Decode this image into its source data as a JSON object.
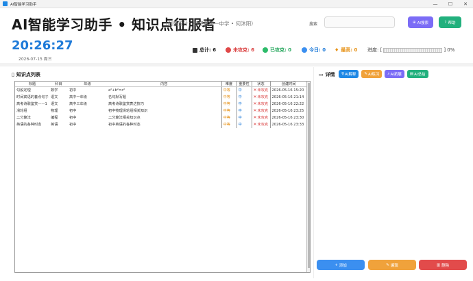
{
  "window": {
    "title": "AI智能学习助手",
    "controls": [
      "—",
      "☐",
      "✕"
    ]
  },
  "header": {
    "title": "AI智能学习助手 • 知识点征服者",
    "subtitle": "（创意设计：会泽县第一中学 • 何沐阳）",
    "search_label": "搜索",
    "search_value": "",
    "ai_search_label": "AI搜索",
    "help_label": "帮助"
  },
  "status": {
    "clock": "20:26:27",
    "date": "2026-07-15 周三",
    "total_label": "总计: 6",
    "undone_label": "未攻克: 6",
    "done_label": "已攻克: 0",
    "today_label": "今日: 0",
    "max_label": "最高: 0",
    "progress_prefix": "进度: [",
    "progress_suffix": "] 0%",
    "progress_value": 0
  },
  "knowledge_list": {
    "title": "知识点列表",
    "columns": [
      "标题",
      "科目",
      "年级",
      "内容",
      "难度",
      "重要性",
      "状态",
      "创建时间"
    ],
    "rows": [
      {
        "title": "勾股定理",
        "subject": "数学",
        "grade": "初中",
        "content": "a²+b²=c²",
        "difficulty": "中等",
        "importance": "中",
        "status": "未攻克",
        "created": "2026-05-16 15:20"
      },
      {
        "title": "时间宾语的套点句子",
        "subject": "语文",
        "grade": "高中一年级",
        "content": "名句默写题",
        "difficulty": "中等",
        "importance": "中",
        "status": "未攻克",
        "created": "2026-05-16 21:14"
      },
      {
        "title": "高考诗歌鉴赏——1",
        "subject": "语文",
        "grade": "高中三年级",
        "content": "高考诗歌鉴赏表达技巧",
        "difficulty": "中等",
        "importance": "中",
        "status": "未攻克",
        "created": "2026-05-16 22:22"
      },
      {
        "title": "滑轮组",
        "subject": "物理",
        "grade": "初中",
        "content": "初中物理滑轮组相关知识",
        "difficulty": "中等",
        "importance": "中",
        "status": "未攻克",
        "created": "2026-05-16 23:25"
      },
      {
        "title": "二分算法",
        "subject": "编程",
        "grade": "初中",
        "content": "二分算法相关知识点",
        "difficulty": "中等",
        "importance": "中",
        "status": "未攻克",
        "created": "2026-05-16 23:30"
      },
      {
        "title": "英语的各种时态",
        "subject": "英语",
        "grade": "初中",
        "content": "初中英语的各种时态",
        "difficulty": "中等",
        "importance": "中",
        "status": "未攻克",
        "created": "2026-05-16 23:33"
      }
    ]
  },
  "details": {
    "title": "详情",
    "buttons": {
      "explain": "AI解释",
      "practice": "AI练习",
      "expand": "AI拓展",
      "summary": "AI总结"
    }
  },
  "actions": {
    "add": "添加",
    "edit": "编辑",
    "delete": "删除"
  },
  "colors": {
    "accent_blue": "#1e7ad8",
    "undone_red": "#d93a3a",
    "done_green": "#22a55a",
    "max_orange": "#e79319",
    "ai_purple": "#7b6cf6"
  }
}
